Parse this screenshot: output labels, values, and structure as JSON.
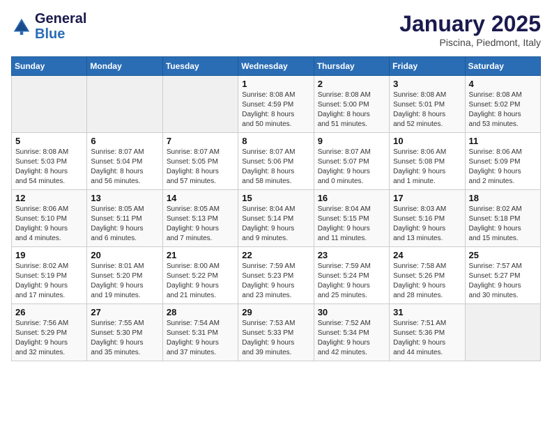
{
  "header": {
    "logo_line1": "General",
    "logo_line2": "Blue",
    "month": "January 2025",
    "location": "Piscina, Piedmont, Italy"
  },
  "days_of_week": [
    "Sunday",
    "Monday",
    "Tuesday",
    "Wednesday",
    "Thursday",
    "Friday",
    "Saturday"
  ],
  "weeks": [
    [
      {
        "day": "",
        "info": ""
      },
      {
        "day": "",
        "info": ""
      },
      {
        "day": "",
        "info": ""
      },
      {
        "day": "1",
        "info": "Sunrise: 8:08 AM\nSunset: 4:59 PM\nDaylight: 8 hours\nand 50 minutes."
      },
      {
        "day": "2",
        "info": "Sunrise: 8:08 AM\nSunset: 5:00 PM\nDaylight: 8 hours\nand 51 minutes."
      },
      {
        "day": "3",
        "info": "Sunrise: 8:08 AM\nSunset: 5:01 PM\nDaylight: 8 hours\nand 52 minutes."
      },
      {
        "day": "4",
        "info": "Sunrise: 8:08 AM\nSunset: 5:02 PM\nDaylight: 8 hours\nand 53 minutes."
      }
    ],
    [
      {
        "day": "5",
        "info": "Sunrise: 8:08 AM\nSunset: 5:03 PM\nDaylight: 8 hours\nand 54 minutes."
      },
      {
        "day": "6",
        "info": "Sunrise: 8:07 AM\nSunset: 5:04 PM\nDaylight: 8 hours\nand 56 minutes."
      },
      {
        "day": "7",
        "info": "Sunrise: 8:07 AM\nSunset: 5:05 PM\nDaylight: 8 hours\nand 57 minutes."
      },
      {
        "day": "8",
        "info": "Sunrise: 8:07 AM\nSunset: 5:06 PM\nDaylight: 8 hours\nand 58 minutes."
      },
      {
        "day": "9",
        "info": "Sunrise: 8:07 AM\nSunset: 5:07 PM\nDaylight: 9 hours\nand 0 minutes."
      },
      {
        "day": "10",
        "info": "Sunrise: 8:06 AM\nSunset: 5:08 PM\nDaylight: 9 hours\nand 1 minute."
      },
      {
        "day": "11",
        "info": "Sunrise: 8:06 AM\nSunset: 5:09 PM\nDaylight: 9 hours\nand 2 minutes."
      }
    ],
    [
      {
        "day": "12",
        "info": "Sunrise: 8:06 AM\nSunset: 5:10 PM\nDaylight: 9 hours\nand 4 minutes."
      },
      {
        "day": "13",
        "info": "Sunrise: 8:05 AM\nSunset: 5:11 PM\nDaylight: 9 hours\nand 6 minutes."
      },
      {
        "day": "14",
        "info": "Sunrise: 8:05 AM\nSunset: 5:13 PM\nDaylight: 9 hours\nand 7 minutes."
      },
      {
        "day": "15",
        "info": "Sunrise: 8:04 AM\nSunset: 5:14 PM\nDaylight: 9 hours\nand 9 minutes."
      },
      {
        "day": "16",
        "info": "Sunrise: 8:04 AM\nSunset: 5:15 PM\nDaylight: 9 hours\nand 11 minutes."
      },
      {
        "day": "17",
        "info": "Sunrise: 8:03 AM\nSunset: 5:16 PM\nDaylight: 9 hours\nand 13 minutes."
      },
      {
        "day": "18",
        "info": "Sunrise: 8:02 AM\nSunset: 5:18 PM\nDaylight: 9 hours\nand 15 minutes."
      }
    ],
    [
      {
        "day": "19",
        "info": "Sunrise: 8:02 AM\nSunset: 5:19 PM\nDaylight: 9 hours\nand 17 minutes."
      },
      {
        "day": "20",
        "info": "Sunrise: 8:01 AM\nSunset: 5:20 PM\nDaylight: 9 hours\nand 19 minutes."
      },
      {
        "day": "21",
        "info": "Sunrise: 8:00 AM\nSunset: 5:22 PM\nDaylight: 9 hours\nand 21 minutes."
      },
      {
        "day": "22",
        "info": "Sunrise: 7:59 AM\nSunset: 5:23 PM\nDaylight: 9 hours\nand 23 minutes."
      },
      {
        "day": "23",
        "info": "Sunrise: 7:59 AM\nSunset: 5:24 PM\nDaylight: 9 hours\nand 25 minutes."
      },
      {
        "day": "24",
        "info": "Sunrise: 7:58 AM\nSunset: 5:26 PM\nDaylight: 9 hours\nand 28 minutes."
      },
      {
        "day": "25",
        "info": "Sunrise: 7:57 AM\nSunset: 5:27 PM\nDaylight: 9 hours\nand 30 minutes."
      }
    ],
    [
      {
        "day": "26",
        "info": "Sunrise: 7:56 AM\nSunset: 5:29 PM\nDaylight: 9 hours\nand 32 minutes."
      },
      {
        "day": "27",
        "info": "Sunrise: 7:55 AM\nSunset: 5:30 PM\nDaylight: 9 hours\nand 35 minutes."
      },
      {
        "day": "28",
        "info": "Sunrise: 7:54 AM\nSunset: 5:31 PM\nDaylight: 9 hours\nand 37 minutes."
      },
      {
        "day": "29",
        "info": "Sunrise: 7:53 AM\nSunset: 5:33 PM\nDaylight: 9 hours\nand 39 minutes."
      },
      {
        "day": "30",
        "info": "Sunrise: 7:52 AM\nSunset: 5:34 PM\nDaylight: 9 hours\nand 42 minutes."
      },
      {
        "day": "31",
        "info": "Sunrise: 7:51 AM\nSunset: 5:36 PM\nDaylight: 9 hours\nand 44 minutes."
      },
      {
        "day": "",
        "info": ""
      }
    ]
  ]
}
